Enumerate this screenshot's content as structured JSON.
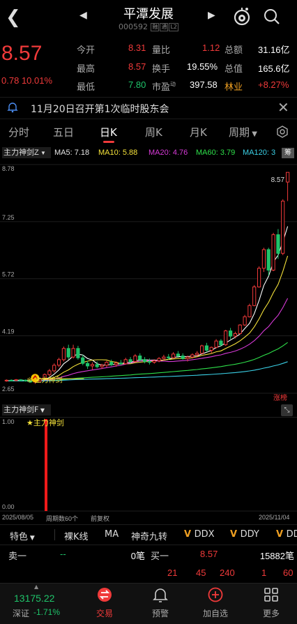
{
  "header": {
    "title": "平潭发展",
    "code": "000592",
    "tag1": "融",
    "tag2": "通",
    "tag3": "L2"
  },
  "quote": {
    "price": "8.57",
    "change": "0.78",
    "change_pct": "10.01%",
    "stats": [
      {
        "label": "今开",
        "value": "8.31"
      },
      {
        "label": "最高",
        "value": "8.57"
      },
      {
        "label": "最低",
        "value": "7.80"
      },
      {
        "label": "量比",
        "value": "1.12"
      },
      {
        "label": "换手",
        "value": "19.55%"
      },
      {
        "label": "市盈",
        "value": "397.58"
      },
      {
        "label": "总额",
        "value": "31.16亿"
      },
      {
        "label": "总值",
        "value": "165.6亿"
      },
      {
        "label": "林业",
        "value": "+8.27%"
      }
    ],
    "pe_superscript": "动"
  },
  "notice": {
    "text": "11月20日召开第1次临时股东会"
  },
  "tabs": [
    "分时",
    "五日",
    "日K",
    "周K",
    "月K",
    "周期"
  ],
  "active_tab": "日K",
  "indicator": {
    "name": "主力神剑Z",
    "ma": [
      {
        "label": "MA5: 7.18",
        "color": "#ffffff"
      },
      {
        "label": "MA10: 5.88",
        "color": "#f5e23a"
      },
      {
        "label": "MA20: 4.76",
        "color": "#d83ad8"
      },
      {
        "label": "MA60: 3.79",
        "color": "#2ee04a"
      },
      {
        "label": "MA120: 3",
        "color": "#3ad0e6"
      }
    ],
    "chou_label": "筹"
  },
  "chart_data": {
    "type": "candlestick",
    "y_ticks": [
      "8.78",
      "7.25",
      "5.72",
      "4.19",
      "2.65"
    ],
    "ylim": [
      2.65,
      8.78
    ],
    "high_label": "8.57",
    "signal_label": "主力神剑",
    "zhangting_label": "涨榜",
    "x_start": "2025/08/05",
    "x_end": "2025/11/04",
    "period_label": "周期数60个",
    "fq_label": "前复权",
    "candles": [
      [
        2.98,
        3.02,
        2.96,
        3.0
      ],
      [
        3.0,
        3.02,
        2.97,
        2.99
      ],
      [
        2.99,
        3.03,
        2.97,
        3.01
      ],
      [
        3.01,
        3.03,
        2.98,
        3.0
      ],
      [
        3.0,
        3.02,
        2.96,
        2.98
      ],
      [
        2.98,
        3.0,
        2.93,
        2.95
      ],
      [
        2.95,
        2.98,
        2.9,
        2.97
      ],
      [
        2.97,
        3.06,
        2.95,
        3.04
      ],
      [
        3.04,
        3.18,
        3.02,
        3.15
      ],
      [
        3.15,
        3.3,
        3.1,
        3.25
      ],
      [
        3.25,
        3.45,
        3.2,
        3.4
      ],
      [
        3.4,
        3.6,
        3.35,
        3.55
      ],
      [
        3.55,
        3.9,
        3.5,
        3.85
      ],
      [
        3.85,
        3.95,
        3.55,
        3.62
      ],
      [
        3.62,
        3.95,
        3.58,
        3.85
      ],
      [
        3.85,
        3.92,
        3.55,
        3.6
      ],
      [
        3.6,
        3.68,
        3.4,
        3.45
      ],
      [
        3.45,
        3.52,
        3.3,
        3.38
      ],
      [
        3.38,
        3.48,
        3.28,
        3.42
      ],
      [
        3.42,
        3.5,
        3.32,
        3.36
      ],
      [
        3.36,
        3.44,
        3.3,
        3.4
      ],
      [
        3.4,
        3.52,
        3.35,
        3.48
      ],
      [
        3.48,
        3.55,
        3.38,
        3.42
      ],
      [
        3.42,
        3.5,
        3.36,
        3.46
      ],
      [
        3.46,
        3.54,
        3.4,
        3.44
      ],
      [
        3.44,
        3.6,
        3.42,
        3.55
      ],
      [
        3.55,
        3.62,
        3.45,
        3.5
      ],
      [
        3.5,
        3.7,
        3.48,
        3.65
      ],
      [
        3.65,
        3.72,
        3.5,
        3.55
      ],
      [
        3.55,
        3.62,
        3.45,
        3.5
      ],
      [
        3.5,
        3.58,
        3.42,
        3.48
      ],
      [
        3.48,
        3.56,
        3.44,
        3.52
      ],
      [
        3.52,
        3.62,
        3.48,
        3.58
      ],
      [
        3.58,
        3.68,
        3.52,
        3.62
      ],
      [
        3.62,
        3.7,
        3.55,
        3.6
      ],
      [
        3.6,
        3.75,
        3.58,
        3.7
      ],
      [
        3.7,
        3.78,
        3.6,
        3.65
      ],
      [
        3.65,
        3.72,
        3.55,
        3.58
      ],
      [
        3.58,
        3.66,
        3.5,
        3.62
      ],
      [
        3.62,
        3.72,
        3.58,
        3.68
      ],
      [
        3.68,
        3.78,
        3.62,
        3.72
      ],
      [
        3.72,
        3.95,
        3.7,
        3.92
      ],
      [
        3.92,
        4.0,
        3.75,
        3.8
      ],
      [
        3.8,
        3.9,
        3.72,
        3.88
      ],
      [
        3.88,
        4.1,
        3.85,
        4.05
      ],
      [
        4.05,
        4.1,
        3.9,
        3.95
      ],
      [
        3.95,
        4.35,
        3.92,
        4.32
      ],
      [
        4.32,
        4.4,
        4.1,
        4.18
      ],
      [
        4.18,
        4.3,
        4.12,
        4.25
      ],
      [
        4.25,
        4.5,
        4.22,
        4.48
      ],
      [
        4.48,
        4.75,
        4.45,
        4.7
      ],
      [
        4.7,
        5.05,
        4.68,
        5.0
      ],
      [
        5.0,
        5.55,
        4.98,
        5.5
      ],
      [
        5.5,
        6.05,
        5.48,
        6.0
      ],
      [
        6.0,
        6.55,
        5.9,
        6.5
      ],
      [
        6.5,
        6.55,
        5.8,
        5.95
      ],
      [
        5.95,
        6.95,
        5.92,
        6.9
      ],
      [
        6.9,
        7.05,
        6.25,
        6.4
      ],
      [
        6.4,
        7.85,
        6.35,
        7.8
      ],
      [
        8.31,
        8.57,
        7.8,
        8.57
      ]
    ]
  },
  "sub_indicator": {
    "name": "主力神剑F",
    "signal_label": "主力神剑",
    "y_top": "1.00",
    "y_bottom": "0.00"
  },
  "toolbar": [
    "特色",
    "裸K线",
    "MA",
    "神奇九转",
    "DDX",
    "DDY",
    "DD"
  ],
  "orderbook": {
    "sell_label": "卖一",
    "sell_price": "--",
    "sell_qty": "0笔",
    "buy_label": "买一",
    "buy_price": "8.57",
    "buy_qty": "15882笔",
    "detail": [
      "21",
      "45",
      "240",
      "1",
      "60"
    ]
  },
  "nav": {
    "index_value": "13175.22",
    "index_name": "深证",
    "index_change": "-1.71%",
    "items": [
      "交易",
      "预警",
      "加自选",
      "更多"
    ]
  }
}
